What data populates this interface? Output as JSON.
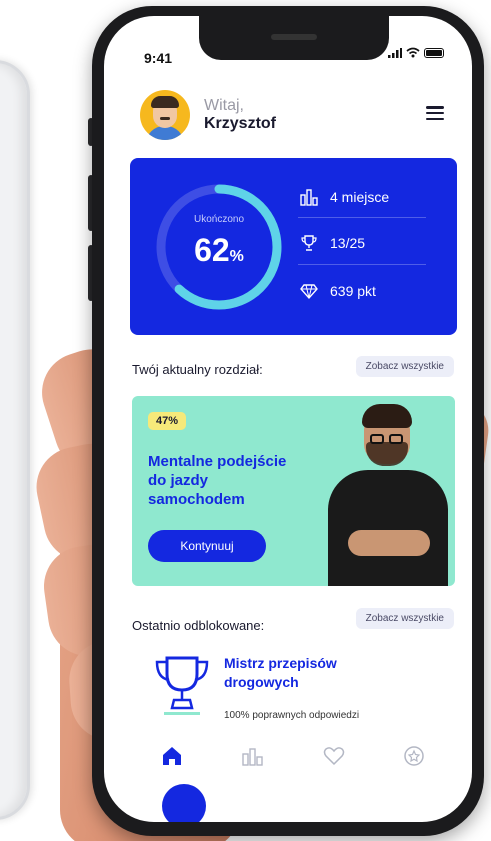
{
  "status": {
    "time": "9:41"
  },
  "header": {
    "greeting": "Witaj,",
    "user_name": "Krzysztof"
  },
  "stats": {
    "progress_label": "Ukończono",
    "progress_value": "62",
    "progress_unit": "%",
    "progress_fraction": 0.62,
    "rank": "4 miejsce",
    "trophies": "13/25",
    "points": "639 pkt",
    "accent": "#1428e0"
  },
  "current_chapter": {
    "section_title": "Twój aktualny rozdział:",
    "see_all": "Zobacz wszystkie",
    "percent": "47%",
    "title": "Mentalne podejście do jazdy samochodem",
    "continue_label": "Kontynuuj",
    "card_color": "#8fe8cf"
  },
  "recently_unlocked": {
    "section_title": "Ostatnio odblokowane:",
    "see_all": "Zobacz wszystkie",
    "item_title": "Mistrz przepisów drogowych",
    "item_desc": "100% poprawnych odpowiedzi"
  },
  "tabbar": {
    "items": [
      {
        "icon": "home-icon",
        "active": true
      },
      {
        "icon": "ranking-icon",
        "active": false
      },
      {
        "icon": "heart-icon",
        "active": false
      },
      {
        "icon": "star-badge-icon",
        "active": false
      }
    ]
  }
}
